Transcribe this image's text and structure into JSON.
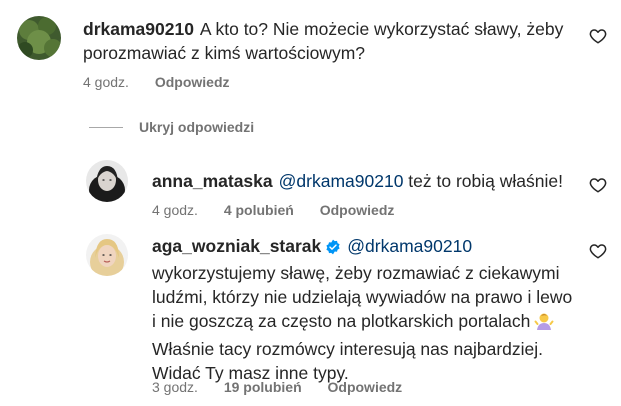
{
  "comments": [
    {
      "username": "drkama90210",
      "text": "A kto to? Nie możecie wykorzystać sławy, żeby porozmawiać z kimś wartościowym?",
      "time": "4 godz.",
      "likes": "",
      "reply_label": "Odpowiedz"
    }
  ],
  "hide_replies_label": "Ukryj odpowiedzi",
  "replies": [
    {
      "username": "anna_mataska",
      "mention": "@drkama90210",
      "text": " też to robią właśnie!",
      "time": "4 godz.",
      "likes": "4 polubień",
      "reply_label": "Odpowiedz"
    },
    {
      "username": "aga_wozniak_starak",
      "verified": true,
      "mention": "@drkama90210",
      "text_line1": "wykorzystujemy sławę, żeby rozmawiać z ciekawymi",
      "text_line2": "ludźmi, którzy nie udzielają wywiadów na prawo i lewo",
      "text_line3": "i nie goszczą za często na plotkarskich portalach",
      "text_line4": "Właśnie tacy rozmówcy interesują nas najbardziej.",
      "text_line5": "Widać Ty masz inne typy.",
      "emoji_icon": "person-shrugging-emoji",
      "time": "3 godz.",
      "likes": "19 polubień",
      "reply_label": "Odpowiedz"
    }
  ],
  "colors": {
    "mention": "#00376b",
    "meta": "#737373",
    "verified": "#0095f6"
  }
}
